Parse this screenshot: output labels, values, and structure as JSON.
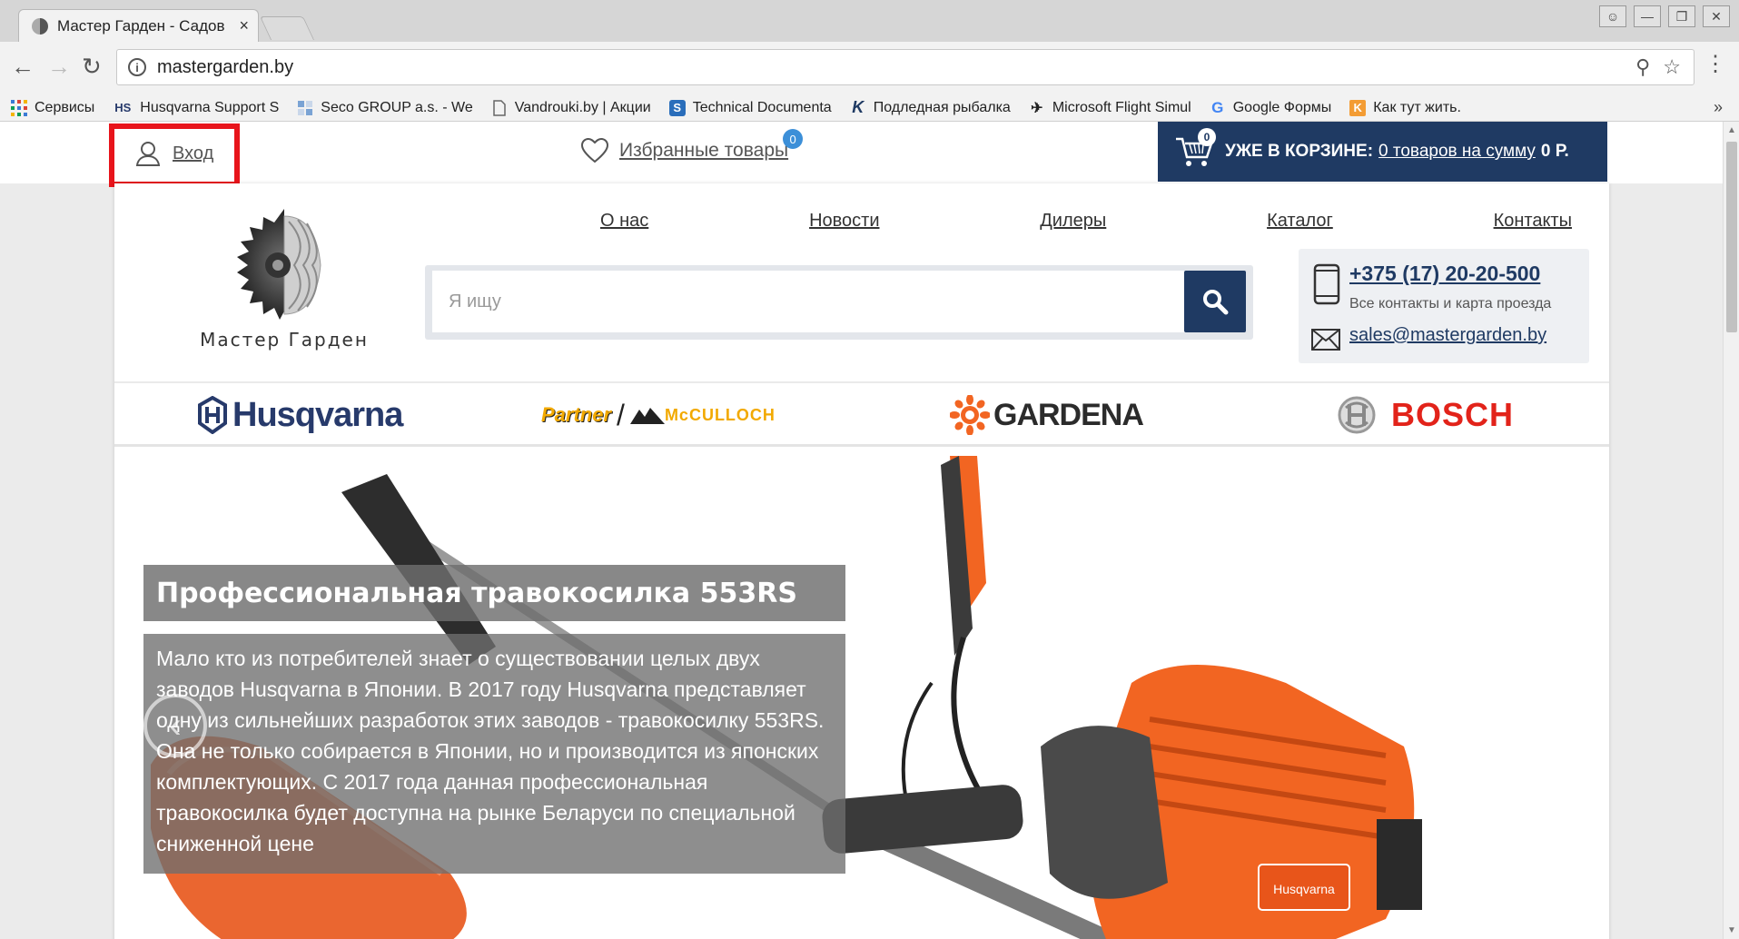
{
  "browser": {
    "tab_title": "Мастер Гарден - Садов",
    "tab_close": "×",
    "url": "mastergarden.by",
    "bookmarks": [
      {
        "label": "Сервисы",
        "icon": "apps-grid-icon"
      },
      {
        "label": "Husqvarna Support S",
        "icon": "hs-icon"
      },
      {
        "label": "Seco GROUP a.s. - We",
        "icon": "seco-icon"
      },
      {
        "label": "Vandrouki.by | Акции",
        "icon": "page-icon"
      },
      {
        "label": "Technical Documenta",
        "icon": "sharepoint-icon"
      },
      {
        "label": "Подледная рыбалка",
        "icon": "k-icon"
      },
      {
        "label": "Microsoft Flight Simul",
        "icon": "plane-icon"
      },
      {
        "label": "Google Формы",
        "icon": "google-icon"
      },
      {
        "label": "Как тут жить.",
        "icon": "k-orange-icon"
      }
    ],
    "bookmarks_more": "»"
  },
  "header": {
    "login": "Вход",
    "favorites": "Избранные товары",
    "favorites_count": "0",
    "cart_prefix": "УЖЕ В КОРЗИНЕ:",
    "cart_link": "0 товаров на сумму",
    "cart_sum": "0 Р.",
    "cart_count": "0"
  },
  "site": {
    "logo_text": "Мастер Гарден",
    "nav": [
      "О нас",
      "Новости",
      "Дилеры",
      "Каталог",
      "Контакты"
    ],
    "search_placeholder": "Я ищу",
    "phone": "+375 (17) 20-20-500",
    "contacts_link": "Все контакты и карта проезда",
    "email": "sales@mastergarden.by"
  },
  "brands": {
    "husqvarna": "Husqvarna",
    "partner": "Partner",
    "mcculloch": "McCULLOCH",
    "gardena": "GARDENA",
    "bosch": "BOSCH"
  },
  "hero": {
    "title": "Профессиональная травокосилка 553RS",
    "text": "Мало кто из потребителей знает о существовании целых двух заводов Husqvarna в Японии. В 2017 году Husqvarna представляет одну из сильнейших разработок этих заводов - травокосилку 553RS. Она не только собирается в Японии, но и производится из японских комплектующих. С 2017 года данная профессиональная травокосилка будет доступна на рынке Беларуси по специальной сниженной цене",
    "product_badge": "Husqvarna"
  },
  "colors": {
    "brand_navy": "#1f3a63",
    "highlight_red": "#e8141b",
    "accent_orange": "#f26522"
  }
}
